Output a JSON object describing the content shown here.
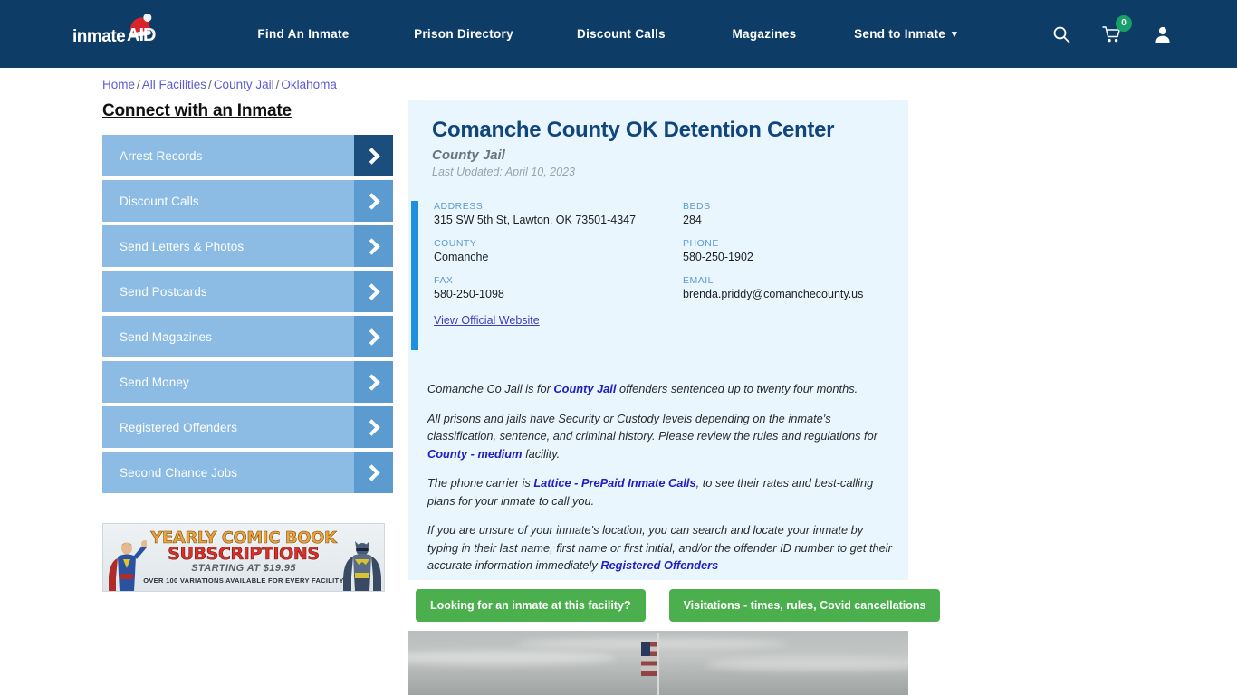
{
  "nav": {
    "logo": {
      "text": "inmate",
      "accent": "AID",
      "icon": "santa-hat-icon"
    },
    "links": [
      {
        "label": "Find An Inmate"
      },
      {
        "label": "Prison Directory"
      },
      {
        "label": "Discount Calls"
      },
      {
        "label": "Magazines"
      },
      {
        "label": "Send to Inmate"
      }
    ],
    "send_to_inmate_caret": "▾",
    "icons": {
      "search": "search-icon",
      "cart": "cart-icon",
      "account": "user-icon"
    },
    "cart_count": "0",
    "colors": {
      "bar": "#0d3c67",
      "badge": "#18a06a"
    }
  },
  "breadcrumb": {
    "items": [
      "Home",
      "All Facilities",
      "County Jail",
      "Oklahoma"
    ],
    "separator": "/"
  },
  "sidebar": {
    "title": "Connect with an Inmate",
    "items": [
      {
        "label": "Arrest Records",
        "active": true
      },
      {
        "label": "Discount Calls",
        "active": false
      },
      {
        "label": "Send Letters & Photos",
        "active": false
      },
      {
        "label": "Send Postcards",
        "active": false
      },
      {
        "label": "Send Magazines",
        "active": false
      },
      {
        "label": "Send Money",
        "active": false
      },
      {
        "label": "Registered Offenders",
        "active": false
      },
      {
        "label": "Second Chance Jobs",
        "active": false
      }
    ]
  },
  "ad": {
    "line1": "YEARLY COMIC BOOK",
    "line2": "SUBSCRIPTIONS",
    "line3": "STARTING AT $19.95",
    "line4": "OVER 100 VARIATIONS AVAILABLE FOR EVERY FACILITY"
  },
  "facility": {
    "title": "Comanche County OK Detention Center",
    "subtitle": "County Jail",
    "last_updated": "Last Updated: April 10, 2023",
    "fields": [
      {
        "label": "ADDRESS",
        "value": "315 SW 5th St, Lawton, OK 73501-4347"
      },
      {
        "label": "BEDS",
        "value": "284"
      },
      {
        "label": "COUNTY",
        "value": "Comanche"
      },
      {
        "label": "PHONE",
        "value": "580-250-1902"
      },
      {
        "label": "FAX",
        "value": "580-250-1098"
      },
      {
        "label": "EMAIL",
        "value": "brenda.priddy@comanchecounty.us"
      }
    ],
    "official_website_link": "View Official Website"
  },
  "description": {
    "p1_a": "Comanche Co Jail is for ",
    "p1_link": "County Jail",
    "p1_b": " offenders sentenced up to twenty four months.",
    "p2_a": "All prisons and jails have Security or Custody levels depending on the inmate's classification, sentence, and criminal history. Please review the rules and regulations for ",
    "p2_link": "County - medium",
    "p2_b": " facility.",
    "p3_a": "The phone carrier is ",
    "p3_link": "Lattice - PrePaid Inmate Calls",
    "p3_b": ", to see their rates and best-calling plans for your inmate to call you.",
    "p4_a": "If you are unsure of your inmate's location, you can search and locate your inmate by typing in their last name, first name or first initial, and/or the offender ID number to get their accurate information immediately ",
    "p4_link": "Registered Offenders"
  },
  "actions": {
    "find_inmate": "Looking for an inmate at this facility?",
    "visitations": "Visitations - times, rules, Covid cancellations",
    "button_color": "#4aaf4c"
  },
  "photo": {
    "alt": "facility-exterior-photo-cloudy-sky-with-flag"
  }
}
